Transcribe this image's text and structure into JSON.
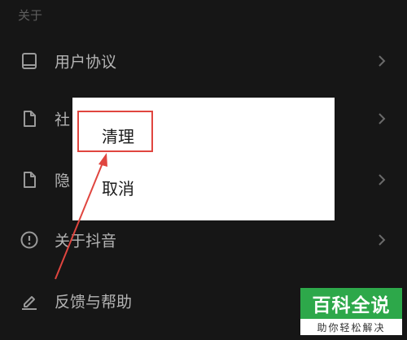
{
  "section": {
    "title": "关于"
  },
  "menu": [
    {
      "label": "用户协议",
      "icon": "book-icon"
    },
    {
      "label": "社",
      "icon": "document-icon"
    },
    {
      "label": "隐",
      "icon": "document-icon"
    },
    {
      "label": "关于抖音",
      "icon": "info-icon"
    },
    {
      "label": "反馈与帮助",
      "icon": "edit-icon"
    }
  ],
  "dialog": {
    "options": [
      {
        "label": "清理"
      },
      {
        "label": "取消"
      }
    ]
  },
  "watermark": {
    "brand": "百科全说",
    "tagline": "助你轻松解决"
  },
  "colors": {
    "background": "#161616",
    "highlight": "#e0453f",
    "watermark_green": "#2da84a"
  }
}
